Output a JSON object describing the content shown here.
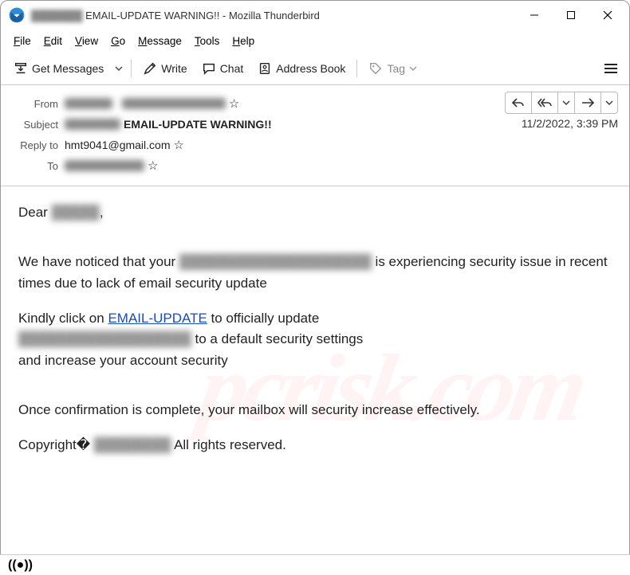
{
  "titlebar": {
    "title": "EMAIL-UPDATE WARNING!! - Mozilla Thunderbird"
  },
  "menubar": {
    "file": "File",
    "edit": "Edit",
    "view": "View",
    "go": "Go",
    "message": "Message",
    "tools": "Tools",
    "help": "Help"
  },
  "toolbar": {
    "get_messages": "Get Messages",
    "write": "Write",
    "chat": "Chat",
    "address_book": "Address Book",
    "tag": "Tag"
  },
  "headers": {
    "from_label": "From",
    "from_value_obscured": "████████   ██████████████",
    "subject_label": "Subject",
    "subject_prefix_obscured": "██████",
    "subject_value": "EMAIL-UPDATE WARNING!!",
    "reply_to_label": "Reply to",
    "reply_to_value": "hmt9041@gmail.com",
    "to_label": "To",
    "to_value_obscured": "███████████",
    "date": "11/2/2022, 3:39 PM"
  },
  "body": {
    "greeting_prefix": "Dear ",
    "greeting_name_obscured": "█████",
    "greeting_suffix": ",",
    "p1_a": "We have noticed that your ",
    "p1_obscured": "████████████████████",
    "p1_b": " is experiencing security issue in recent times due to lack of email security update",
    "p2_a": "Kindly click on ",
    "p2_link": "EMAIL-UPDATE",
    "p2_b": " to officially update ",
    "p2_obscured": "██████████████████",
    "p2_c": " to a default security settings",
    "p2_d": "and increase your account security",
    "p3": "Once confirmation is complete, your mailbox will security increase effectively.",
    "p4_a": "Copyright� ",
    "p4_obscured": "████████",
    "p4_b": " All rights reserved."
  },
  "watermark": "pcrisk.com"
}
